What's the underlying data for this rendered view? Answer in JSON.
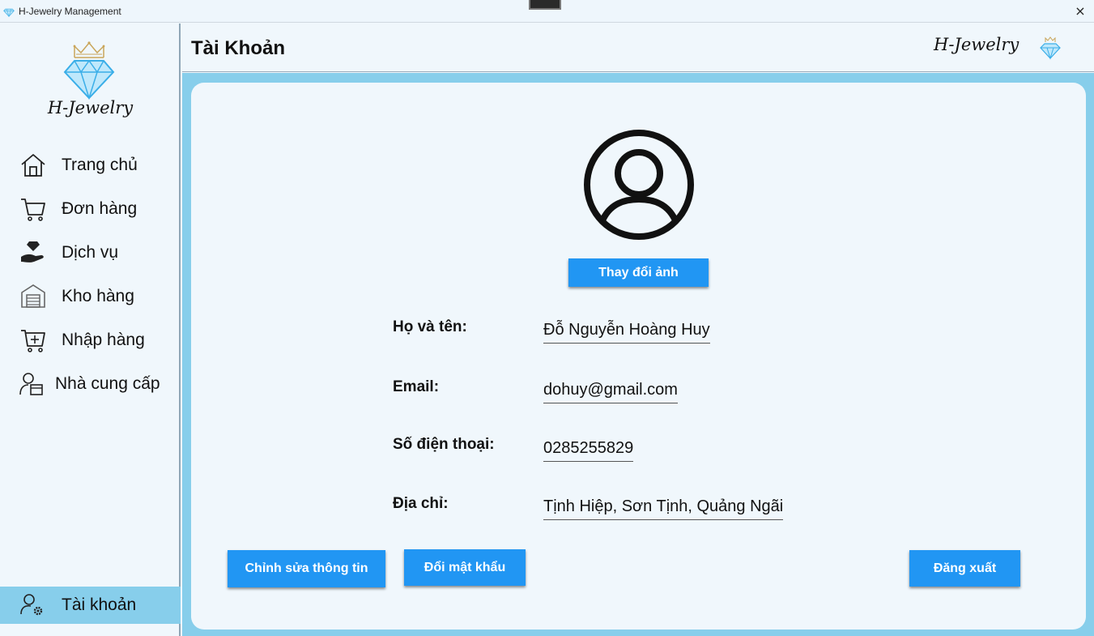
{
  "window": {
    "title": "H-Jewelry Management",
    "close_glyph": "×"
  },
  "brand": {
    "name": "H-Jewelry"
  },
  "sidebar": {
    "items": [
      {
        "label": "Trang chủ",
        "icon": "home-icon"
      },
      {
        "label": "Đơn hàng",
        "icon": "cart-icon"
      },
      {
        "label": "Dịch vụ",
        "icon": "service-hand-icon"
      },
      {
        "label": "Kho hàng",
        "icon": "warehouse-icon"
      },
      {
        "label": "Nhập hàng",
        "icon": "cart-add-icon"
      },
      {
        "label": "Nhà cung cấp",
        "icon": "supplier-icon"
      }
    ],
    "account": {
      "label": "Tài khoản",
      "icon": "user-gear-icon",
      "active": true
    }
  },
  "header": {
    "title": "Tài Khoản"
  },
  "profile": {
    "change_photo_label": "Thay đổi ảnh",
    "fields": [
      {
        "label": "Họ và tên:",
        "value": "Đỗ Nguyễn Hoàng Huy"
      },
      {
        "label": "Email:",
        "value": "dohuy@gmail.com"
      },
      {
        "label": "Số điện thoại:",
        "value": "0285255829"
      },
      {
        "label": "Địa chỉ:",
        "value": "Tịnh Hiệp, Sơn Tịnh, Quảng Ngãi"
      }
    ]
  },
  "actions": {
    "edit_label": "Chỉnh sửa thông tin",
    "change_password_label": "Đổi mật khẩu",
    "logout_label": "Đăng xuất"
  },
  "colors": {
    "accent": "#2196f3",
    "sidebar_active": "#87ceeb",
    "main_bg": "#87ceeb",
    "card_bg": "#f0f7fc"
  }
}
